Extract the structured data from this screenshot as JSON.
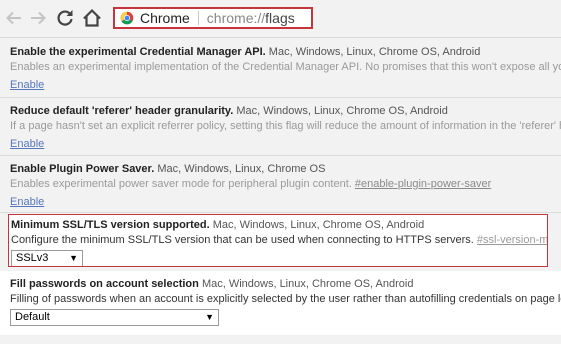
{
  "browser": {
    "chip_label": "Chrome",
    "url_scheme": "chrome://",
    "url_path": "flags"
  },
  "flags": [
    {
      "name": "Enable the experimental Credential Manager API.",
      "platforms": "Mac, Windows, Linux, Chrome OS, Android",
      "description": "Enables an experimental implementation of the Credential Manager API. No promises that this won't expose all your p",
      "action": "Enable"
    },
    {
      "name": "Reduce default 'referer' header granularity.",
      "platforms": "Mac, Windows, Linux, Chrome OS, Android",
      "description": "If a page hasn't set an explicit referrer policy, setting this flag will reduce the amount of information in the 'referer' heac",
      "action": "Enable"
    },
    {
      "name": "Enable Plugin Power Saver.",
      "platforms": "Mac, Windows, Linux, Chrome OS",
      "description": "Enables experimental power saver mode for peripheral plugin content.",
      "hash": "#enable-plugin-power-saver",
      "action": "Enable"
    },
    {
      "name": "Minimum SSL/TLS version supported.",
      "platforms": "Mac, Windows, Linux, Chrome OS, Android",
      "description": "Configure the minimum SSL/TLS version that can be used when connecting to HTTPS servers.",
      "hash": "#ssl-version-min",
      "select_value": "SSLv3"
    },
    {
      "name": "Fill passwords on account selection",
      "platforms": "Mac, Windows, Linux, Chrome OS, Android",
      "description": "Filling of passwords when an account is explicitly selected by the user rather than autofilling credentials on page load.",
      "select_value": "Default"
    }
  ]
}
